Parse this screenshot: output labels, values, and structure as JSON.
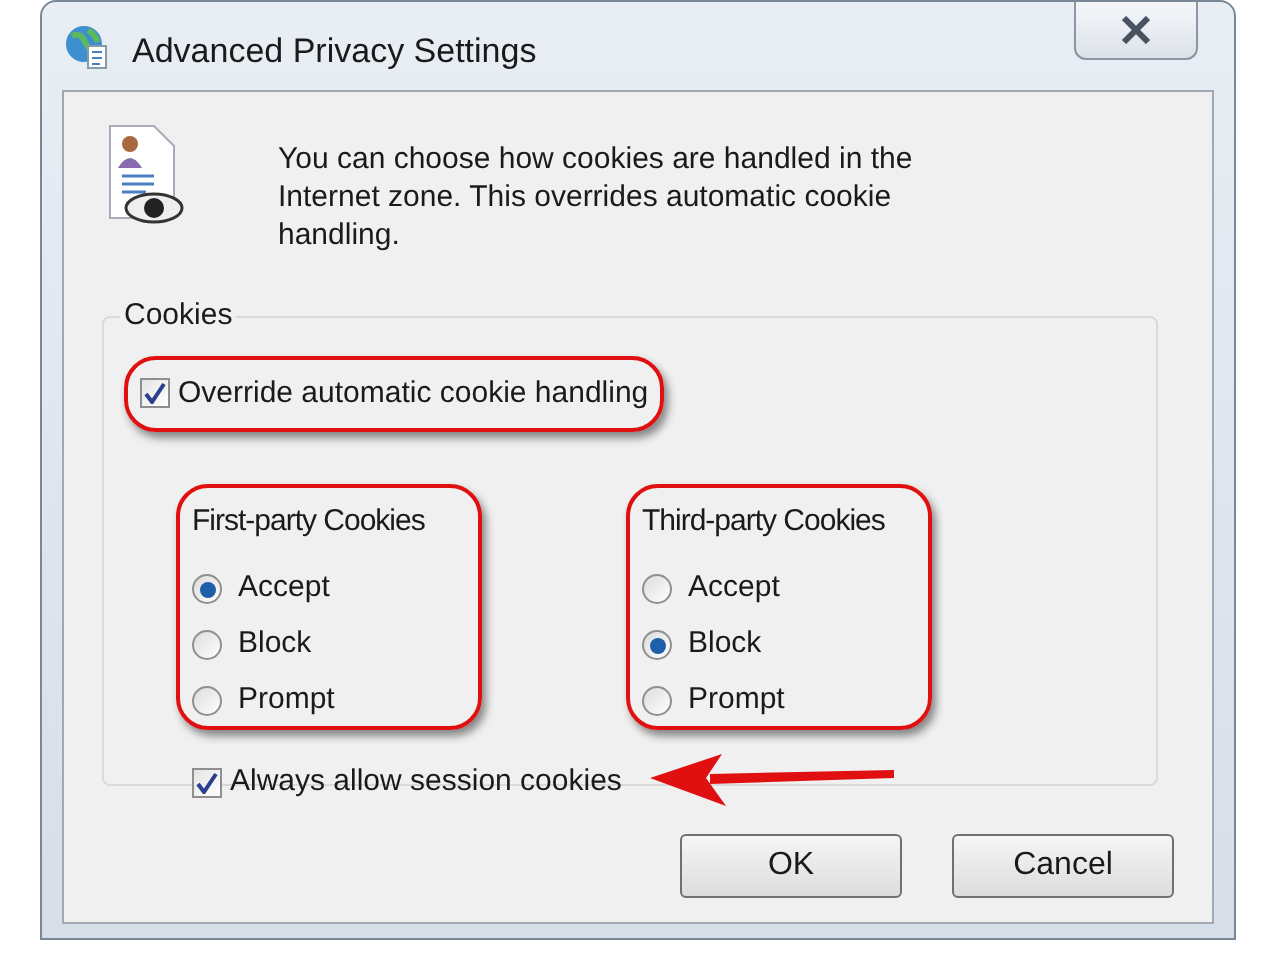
{
  "window": {
    "title": "Advanced Privacy Settings"
  },
  "intro": "You can choose how cookies are handled in the Internet zone.  This overrides automatic cookie handling.",
  "cookies": {
    "title": "Cookies",
    "override": {
      "label": "Override automatic cookie handling",
      "checked": true,
      "highlighted": true
    },
    "groups": [
      {
        "title": "First-party Cookies",
        "highlighted": true,
        "options": [
          {
            "label": "Accept",
            "selected": true
          },
          {
            "label": "Block",
            "selected": false
          },
          {
            "label": "Prompt",
            "selected": false
          }
        ]
      },
      {
        "title": "Third-party Cookies",
        "highlighted": true,
        "options": [
          {
            "label": "Accept",
            "selected": false
          },
          {
            "label": "Block",
            "selected": true
          },
          {
            "label": "Prompt",
            "selected": false
          }
        ]
      }
    ],
    "session": {
      "label": "Always allow session cookies",
      "checked": true,
      "pointed": true
    }
  },
  "buttons": [
    {
      "label": "OK"
    },
    {
      "label": "Cancel"
    }
  ]
}
